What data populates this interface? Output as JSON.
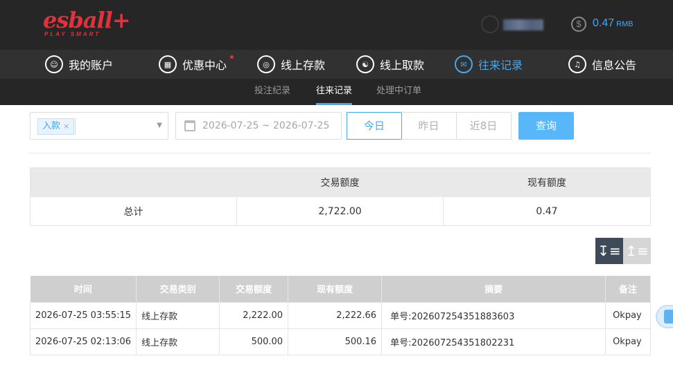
{
  "brand": {
    "logo_main": "esball+",
    "logo_sub": "PLAY SMART"
  },
  "account": {
    "balance": "0.47",
    "currency": "RMB"
  },
  "colors": {
    "accent": "#45a8ee",
    "brand_red": "#e0323a",
    "header_bg": "#262626"
  },
  "main_nav": [
    {
      "label": "我的账户",
      "icon": "user-icon"
    },
    {
      "label": "优惠中心",
      "icon": "gift-icon"
    },
    {
      "label": "线上存款",
      "icon": "deposit-icon"
    },
    {
      "label": "线上取款",
      "icon": "withdraw-icon"
    },
    {
      "label": "往来记录",
      "icon": "records-icon",
      "active": true
    },
    {
      "label": "信息公告",
      "icon": "bell-icon"
    }
  ],
  "sub_nav": [
    {
      "label": "投注纪录"
    },
    {
      "label": "往来记录",
      "active": true
    },
    {
      "label": "处理中订单"
    }
  ],
  "filters": {
    "type_tag": "入款",
    "date_range": "2026-07-25 ~ 2026-07-25",
    "quick_ranges": [
      "今日",
      "昨日",
      "近8日"
    ],
    "selected_range": "今日",
    "query_label": "查询"
  },
  "summary": {
    "headers": [
      "",
      "交易额度",
      "现有额度"
    ],
    "row": [
      "总计",
      "2,722.00",
      "0.47"
    ]
  },
  "records": {
    "headers": [
      "时间",
      "交易类别",
      "交易额度",
      "现有额度",
      "摘要",
      "备注"
    ],
    "rows": [
      [
        "2026-07-25 03:55:15",
        "线上存款",
        "2,222.00",
        "2,222.66",
        "单号:202607254351883603",
        "Okpay"
      ],
      [
        "2026-07-25 02:13:06",
        "线上存款",
        "500.00",
        "500.16",
        "单号:202607254351802231",
        "Okpay"
      ]
    ]
  }
}
